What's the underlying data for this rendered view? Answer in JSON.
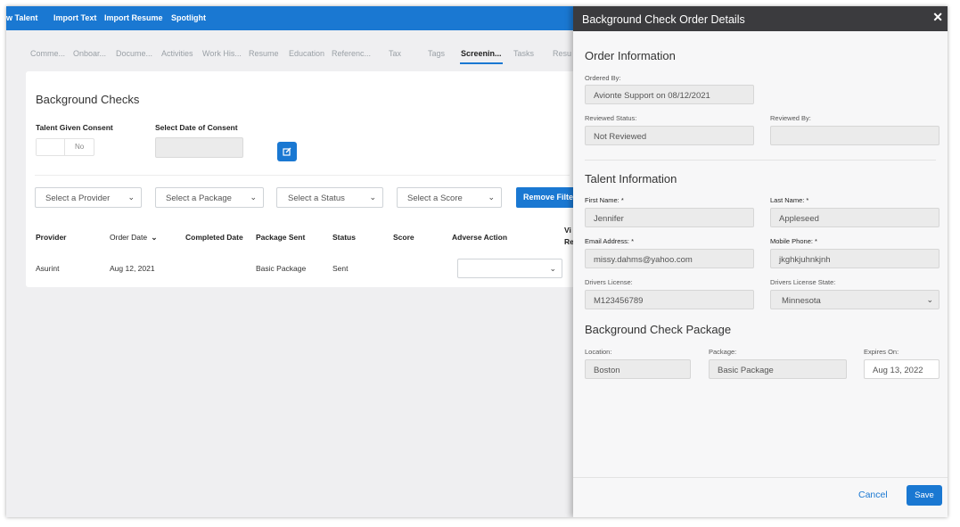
{
  "topbar": {
    "items": [
      "w Talent",
      "Import Text",
      "Import Resume",
      "Spotlight"
    ]
  },
  "tabs": [
    "Comme...",
    "Onboar...",
    "Docume...",
    "Activities",
    "Work His...",
    "Resume",
    "Education",
    "Referenc...",
    "Tax",
    "Tags",
    "Screenin...",
    "Tasks",
    "Resu"
  ],
  "active_tab": "Screenin...",
  "background_checks": {
    "title": "Background Checks",
    "consent_label": "Talent Given Consent",
    "consent_value": "No",
    "date_label": "Select Date of Consent",
    "filters": {
      "provider": "Select a Provider",
      "package": "Select a Package",
      "status": "Select a Status",
      "score": "Select a Score",
      "remove_label": "Remove Filters"
    },
    "columns": [
      "Provider",
      "Order Date",
      "Completed Date",
      "Package Sent",
      "Status",
      "Score",
      "Adverse Action",
      "Vi",
      "Re"
    ],
    "rows": [
      {
        "provider": "Asurint",
        "order_date": "Aug 12, 2021",
        "completed_date": "",
        "package_sent": "Basic Package",
        "status": "Sent",
        "score": ""
      }
    ]
  },
  "panel": {
    "title": "Background Check Order Details",
    "order_info": {
      "title": "Order Information",
      "ordered_by_label": "Ordered By:",
      "ordered_by": "Avionte Support on 08/12/2021",
      "reviewed_status_label": "Reviewed Status:",
      "reviewed_status": "Not Reviewed",
      "reviewed_by_label": "Reviewed By:",
      "reviewed_by": ""
    },
    "talent_info": {
      "title": "Talent Information",
      "first_name_label": "First Name: *",
      "first_name": "Jennifer",
      "last_name_label": "Last Name: *",
      "last_name": "Appleseed",
      "email_label": "Email Address: *",
      "email": "missy.dahms@yahoo.com",
      "mobile_label": "Mobile Phone: *",
      "mobile": "jkghkjuhnkjnh",
      "dl_label": "Drivers License:",
      "dl": "M123456789",
      "dl_state_label": "Drivers License State:",
      "dl_state": "Minnesota"
    },
    "package_info": {
      "title": "Background Check Package",
      "location_label": "Location:",
      "location": "Boston",
      "package_label": "Package:",
      "package": "Basic Package",
      "expires_label": "Expires On:",
      "expires": "Aug 13, 2022"
    },
    "cancel_label": "Cancel",
    "save_label": "Save"
  },
  "colors": {
    "accent": "#1a78d2",
    "panel_header": "#3b3b3e"
  }
}
